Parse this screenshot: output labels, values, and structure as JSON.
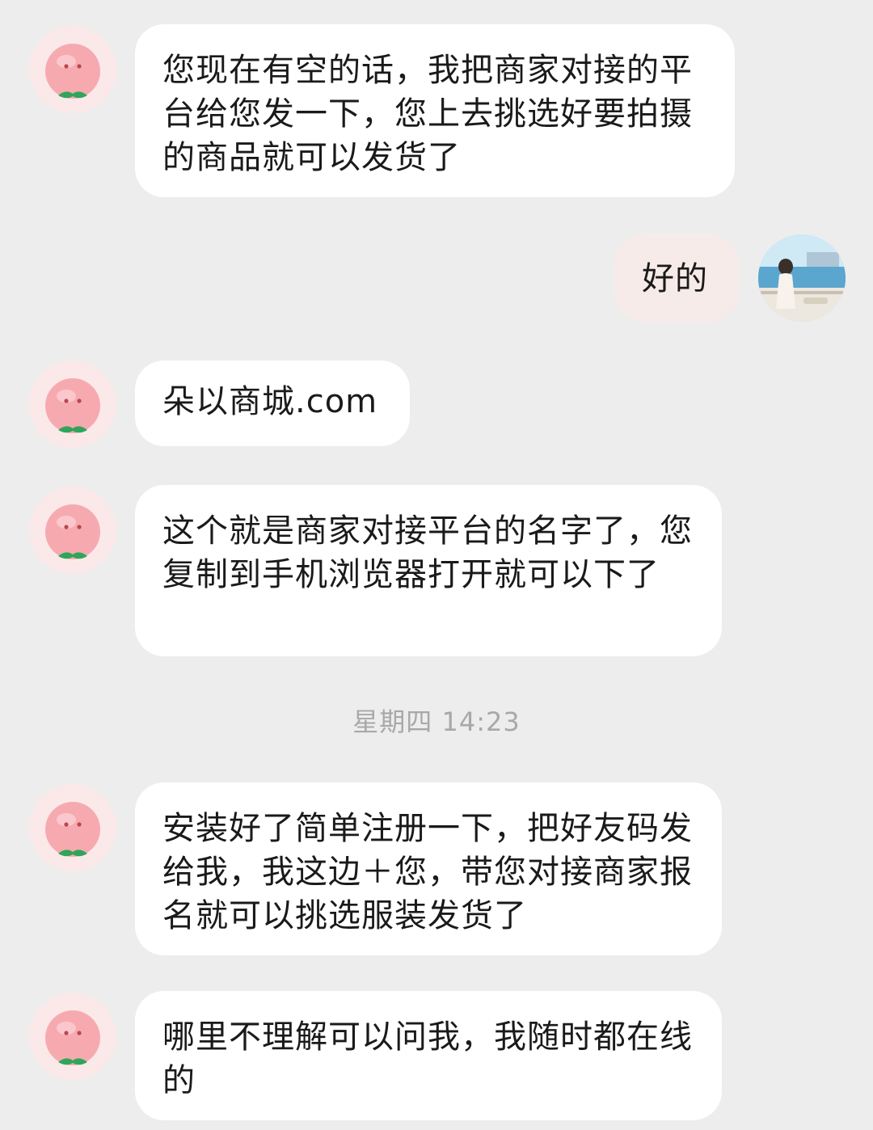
{
  "messages": [
    {
      "sender": "contact",
      "avatar_icon": "peach-icon",
      "text": "您现在有空的话，我把商家对接的平 台给您发一下，您上去挑选好要拍摄的商品就可以发货了"
    },
    {
      "sender": "me",
      "avatar_icon": "user-photo-avatar",
      "text": "好的"
    },
    {
      "sender": "contact",
      "avatar_icon": "peach-icon",
      "text": "朵以商城.com"
    },
    {
      "sender": "contact",
      "avatar_icon": "peach-icon",
      "text": "这个就是商家对接平台的名字了，您复制到手机浏览器打开就可以下了"
    },
    {
      "sender": "contact",
      "avatar_icon": "peach-icon",
      "text": "安装好了简单注册一下，把好友码发给我，我这边＋您，带您对接商家报名就可以挑选服装发货了"
    },
    {
      "sender": "contact",
      "avatar_icon": "peach-icon",
      "text": "哪里不理解可以问我，我随时都在线的"
    }
  ],
  "timestamp": "星期四 14:23",
  "colors": {
    "background": "#ededed",
    "bubble_contact": "#ffffff",
    "bubble_me": "#f7ebe9",
    "peach": "#f4a8ae",
    "leaf": "#2fa55a"
  }
}
